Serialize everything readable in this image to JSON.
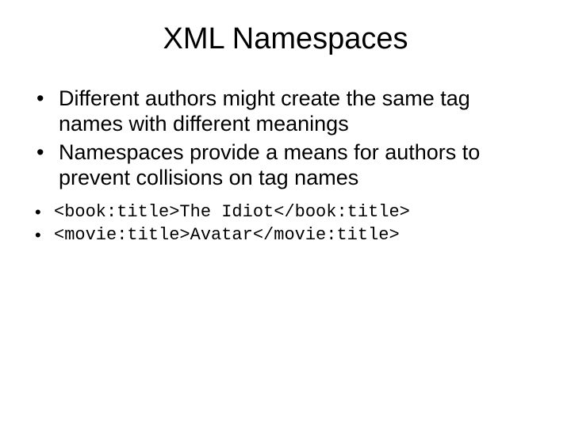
{
  "title": "XML Namespaces",
  "bullets": [
    "Different authors might create the same tag names with different meanings",
    "Namespaces provide a means for authors to prevent collisions on tag names"
  ],
  "code_lines": [
    "<book:title>The Idiot</book:title>",
    "<movie:title>Avatar</movie:title>"
  ]
}
